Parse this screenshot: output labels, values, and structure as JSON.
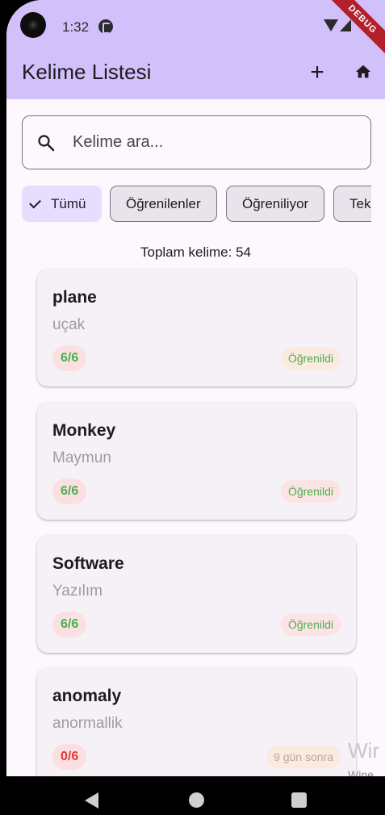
{
  "status_bar": {
    "time": "1:32"
  },
  "debug_label": "DEBUG",
  "app_bar": {
    "title": "Kelime Listesi",
    "add_label": "+"
  },
  "search": {
    "placeholder": "Kelime ara..."
  },
  "filters": [
    {
      "label": "Tümü",
      "selected": true
    },
    {
      "label": "Öğrenilenler",
      "selected": false
    },
    {
      "label": "Öğreniliyor",
      "selected": false
    },
    {
      "label": "Tek",
      "selected": false
    }
  ],
  "total_label": "Toplam kelime: 54",
  "words": [
    {
      "word": "plane",
      "meaning": "uçak",
      "progress": "6/6",
      "status": "Öğrenildi",
      "progress_color": "#4caf50",
      "status_color": "#4caf50"
    },
    {
      "word": "Monkey",
      "meaning": "Maymun",
      "progress": "6/6",
      "status": "Öğrenildi",
      "progress_color": "#4caf50",
      "status_color": "#4caf50"
    },
    {
      "word": "Software",
      "meaning": "Yazılım",
      "progress": "6/6",
      "status": "Öğrenildi",
      "progress_color": "#4caf50",
      "status_color": "#4caf50"
    },
    {
      "word": "anomaly",
      "meaning": "anormallik",
      "progress": "0/6",
      "status": "9 gün sonra",
      "progress_color": "#e53935",
      "status_color": "#b9a6a0"
    }
  ],
  "watermark": {
    "title": "Wir",
    "subtitle": "Wine"
  },
  "colors": {
    "app_bar": "#d2c0fa",
    "background": "#fdf7fe",
    "selected_chip": "#e9ddff"
  }
}
